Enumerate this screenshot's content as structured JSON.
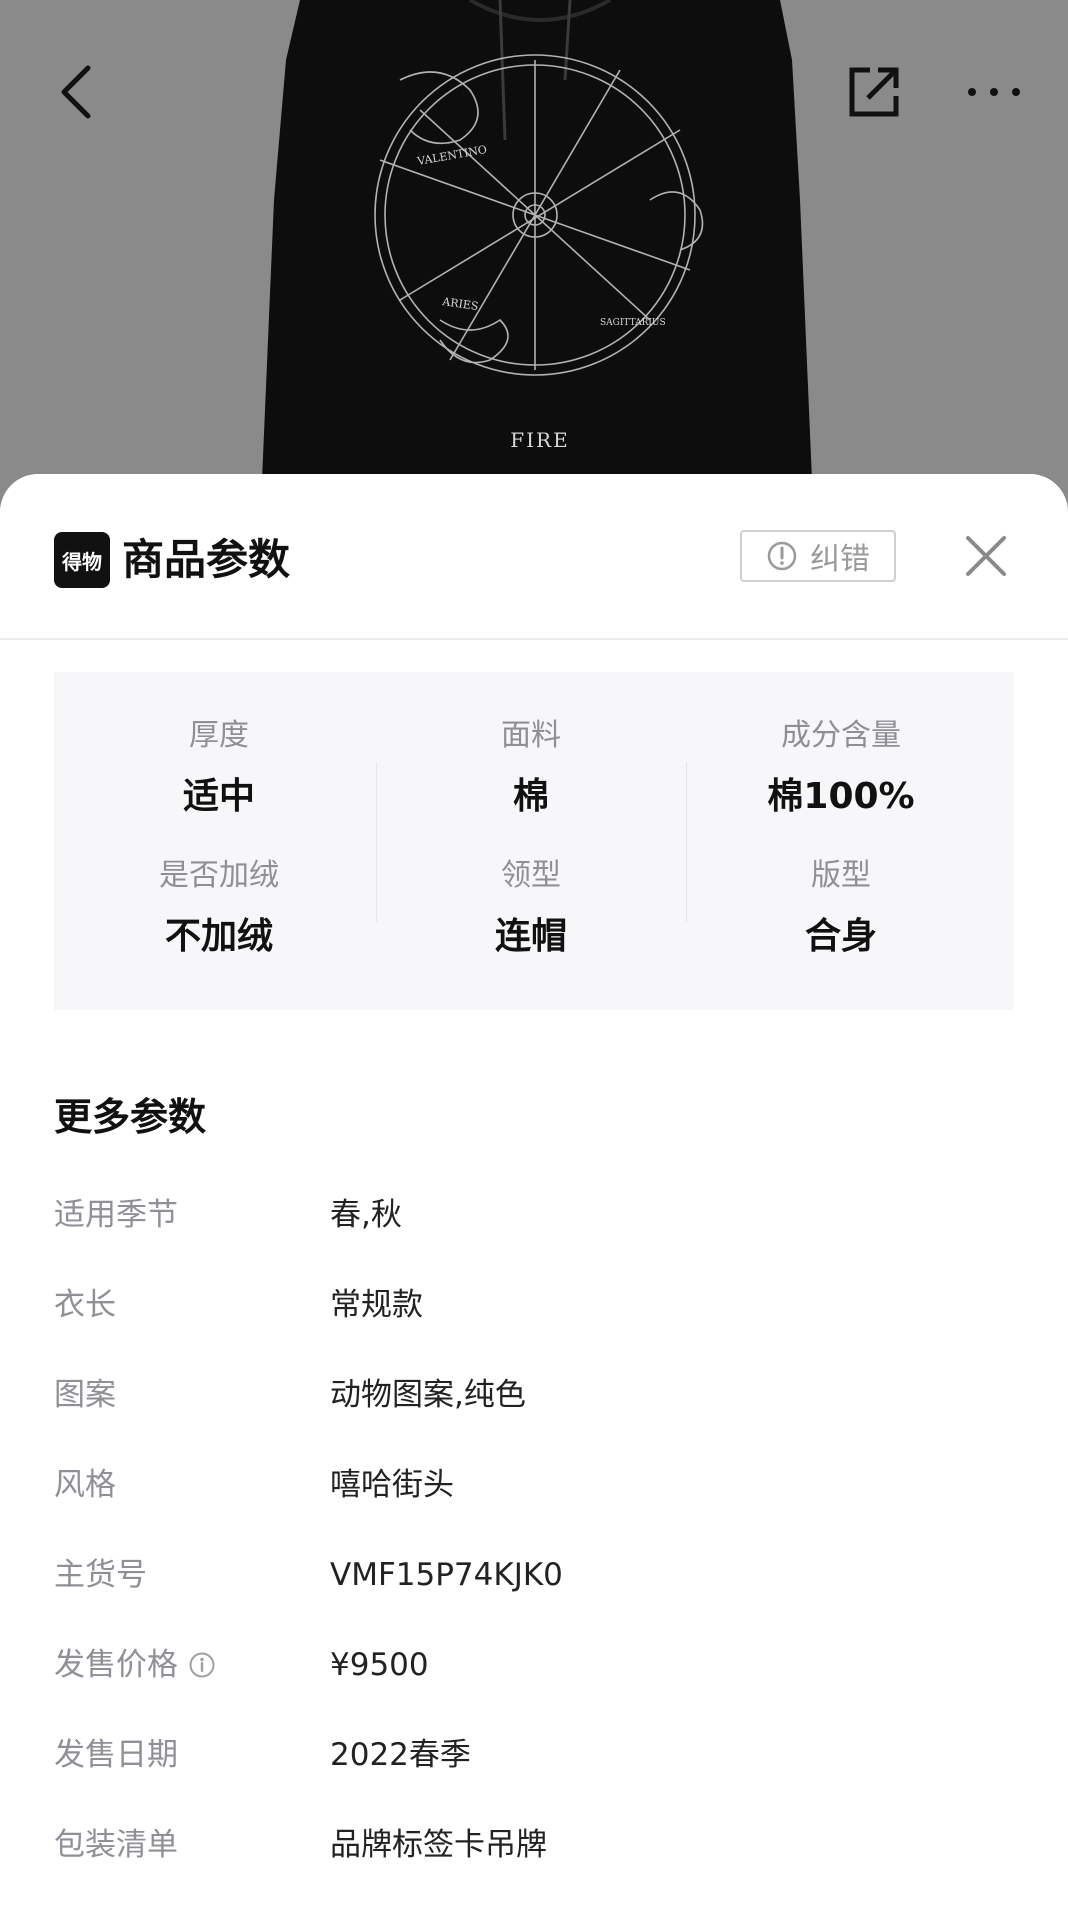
{
  "hero": {
    "print_text_fire": "FIRE",
    "print_text_valentino": "VALENTINO",
    "print_text_aries": "ARIES",
    "print_text_sagittarius": "SAGITTARIUS"
  },
  "nav": {
    "back_icon": "chevron-left-icon",
    "share_icon": "share-external-icon",
    "more_icon": "more-dots-icon"
  },
  "sheet": {
    "brand_logo_text": "得物",
    "title": "商品参数",
    "report_label": "纠错",
    "close_icon": "close-icon"
  },
  "key_params": [
    {
      "label": "厚度",
      "value": "适中"
    },
    {
      "label": "面料",
      "value": "棉"
    },
    {
      "label": "成分含量",
      "value": "棉100%"
    },
    {
      "label": "是否加绒",
      "value": "不加绒"
    },
    {
      "label": "领型",
      "value": "连帽"
    },
    {
      "label": "版型",
      "value": "合身"
    }
  ],
  "more_params": {
    "title": "更多参数",
    "rows": [
      {
        "key": "适用季节",
        "value": "春,秋"
      },
      {
        "key": "衣长",
        "value": "常规款"
      },
      {
        "key": "图案",
        "value": "动物图案,纯色"
      },
      {
        "key": "风格",
        "value": "嘻哈街头"
      },
      {
        "key": "主货号",
        "value": "VMF15P74KJK0"
      },
      {
        "key": "发售价格",
        "value": "¥9500",
        "has_info": true
      },
      {
        "key": "发售日期",
        "value": "2022春季"
      },
      {
        "key": "包装清单",
        "value": "品牌标签卡吊牌"
      }
    ]
  },
  "colors": {
    "hero_bg": "#8a8a8a",
    "hoodie": "#0d0d0d",
    "print": "#d8d8d8",
    "muted_text": "#8f8f96",
    "panel_bg": "#f7f7f9"
  }
}
